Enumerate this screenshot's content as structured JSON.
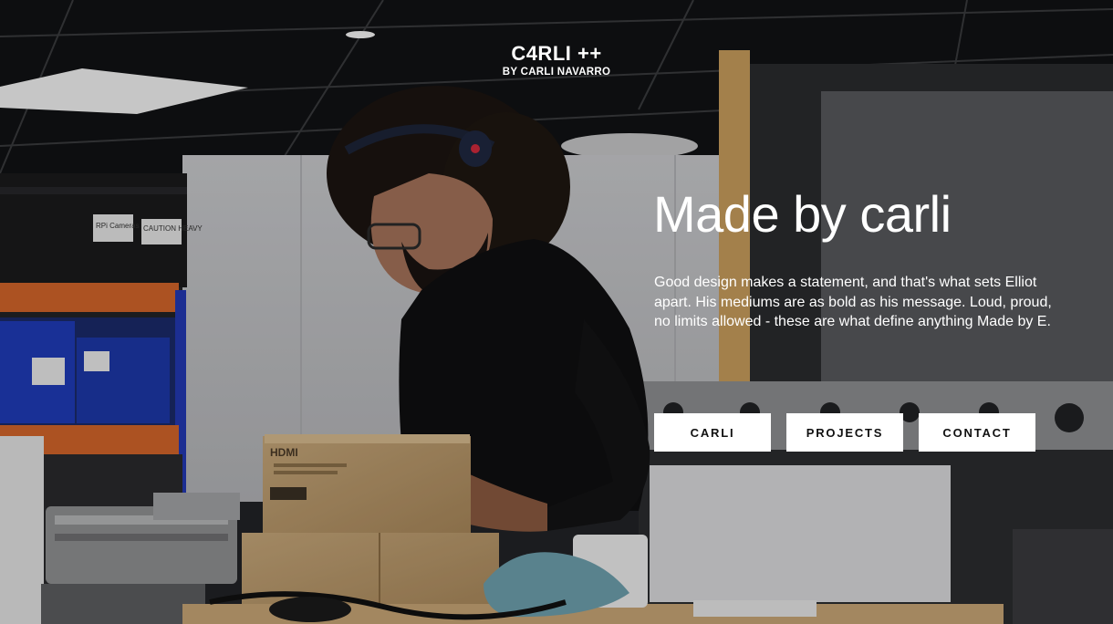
{
  "brand": {
    "title": "C4RLI ++",
    "subtitle": "BY CARLI NAVARRO"
  },
  "hero": {
    "headline": "Made by carli",
    "intro": "Good design makes a statement, and that's what sets Elliot apart. His mediums are as bold as his message. Loud, proud, no limits allowed - these are what define anything Made by E.",
    "photo_labels": {
      "bin_left": "RPi Cameras",
      "bin_right": "CAUTION HEAVY",
      "box": "HDMI"
    }
  },
  "nav": {
    "items": [
      {
        "label": "CARLI"
      },
      {
        "label": "PROJECTS"
      },
      {
        "label": "CONTACT"
      }
    ]
  },
  "colors": {
    "button_bg": "#ffffff",
    "button_text": "#111111",
    "shelf_orange": "#d2642a",
    "bin_blue": "#1d37a8"
  }
}
